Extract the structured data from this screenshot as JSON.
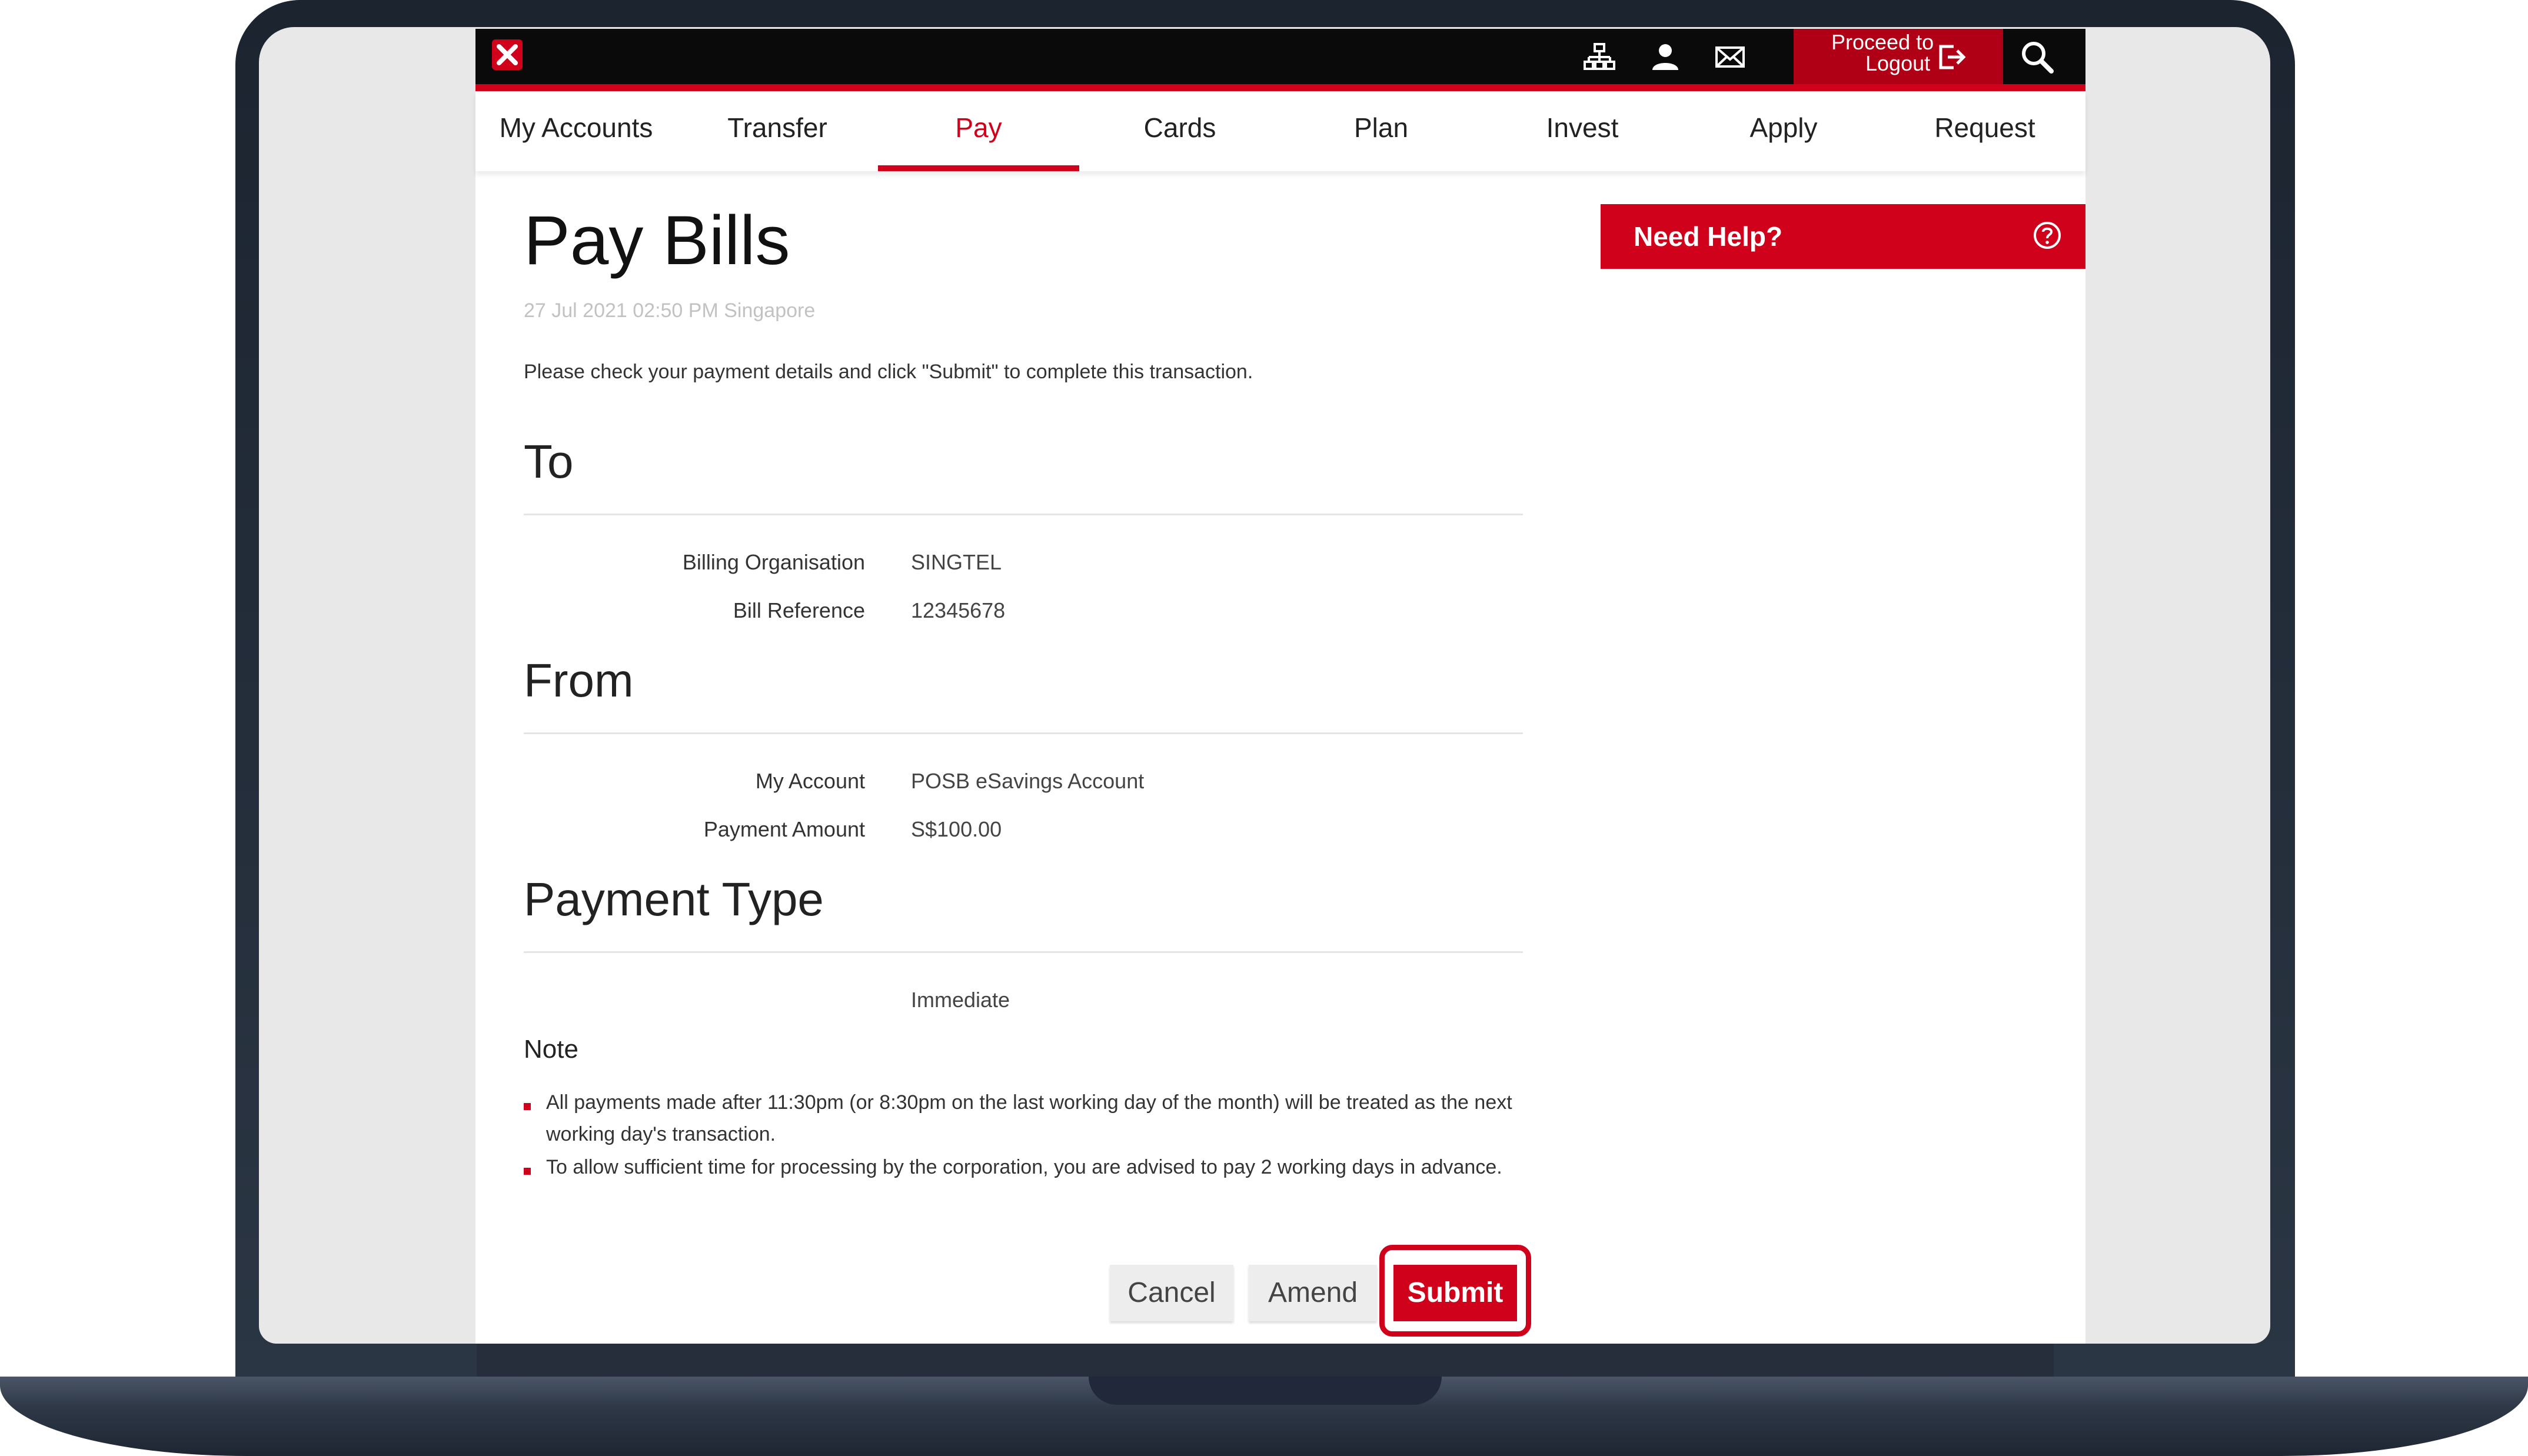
{
  "header": {
    "logout_line1": "Proceed to",
    "logout_line2": "Logout",
    "icons": [
      "sitemap-icon",
      "user-icon",
      "mail-icon",
      "logout-icon",
      "search-icon"
    ]
  },
  "nav": {
    "items": [
      {
        "label": "My Accounts"
      },
      {
        "label": "Transfer"
      },
      {
        "label": "Pay"
      },
      {
        "label": "Cards"
      },
      {
        "label": "Plan"
      },
      {
        "label": "Invest"
      },
      {
        "label": "Apply"
      },
      {
        "label": "Request"
      }
    ],
    "active": "Pay"
  },
  "main": {
    "title": "Pay Bills",
    "datetime": "27 Jul 2021 02:50 PM Singapore",
    "intro": "Please check your payment details and click \"Submit\" to complete this transaction.",
    "to": {
      "heading": "To",
      "billing_org_label": "Billing Organisation",
      "billing_org_value": "SINGTEL",
      "bill_ref_label": "Bill Reference",
      "bill_ref_value": "12345678"
    },
    "from": {
      "heading": "From",
      "account_label": "My Account",
      "account_value": "POSB eSavings Account",
      "amount_label": "Payment Amount",
      "amount_value": "S$100.00"
    },
    "payment_type": {
      "heading": "Payment Type",
      "value": "Immediate"
    },
    "note": {
      "heading": "Note",
      "items": [
        "All payments made after 11:30pm (or 8:30pm on the last working day of the month) will be treated as the next working day's transaction.",
        "To allow sufficient time for processing by the corporation, you are advised to pay 2 working days in advance."
      ]
    },
    "buttons": {
      "cancel": "Cancel",
      "amend": "Amend",
      "submit": "Submit"
    }
  },
  "sidebar": {
    "help_label": "Need Help?"
  },
  "colors": {
    "brand_red": "#d0021b",
    "topbar": "#0a0a0a"
  }
}
